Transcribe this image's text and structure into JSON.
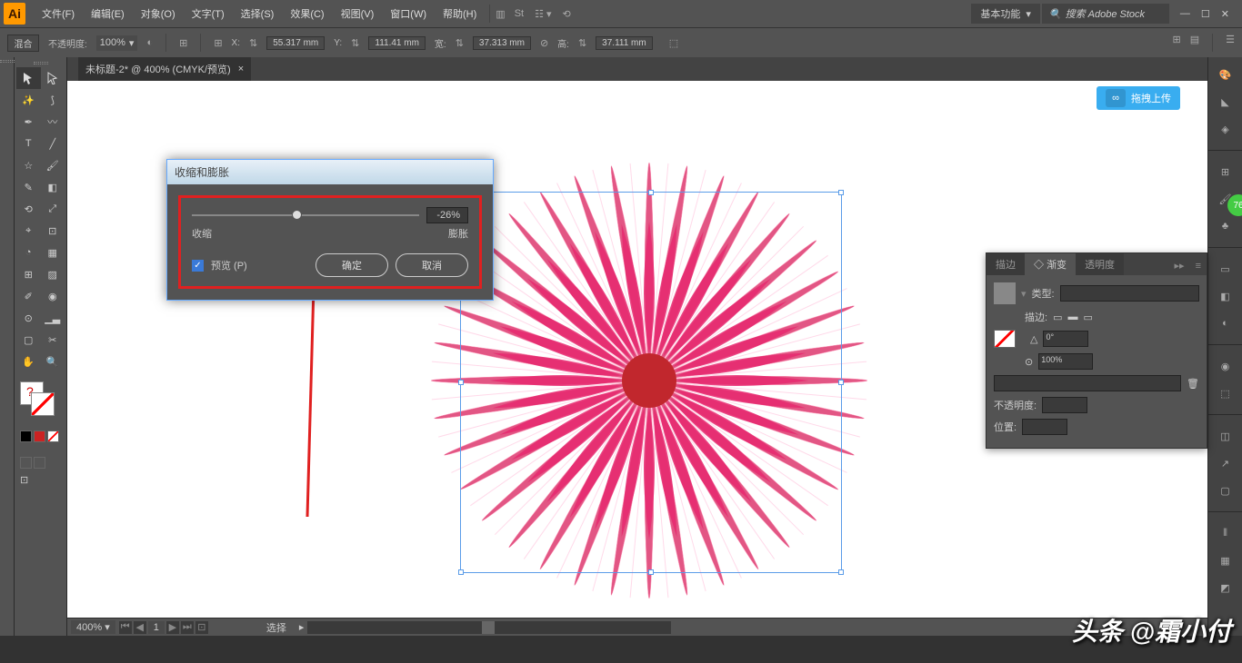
{
  "menu": {
    "file": "文件(F)",
    "edit": "编辑(E)",
    "object": "对象(O)",
    "type": "文字(T)",
    "select": "选择(S)",
    "effect": "效果(C)",
    "view": "视图(V)",
    "window": "窗口(W)",
    "help": "帮助(H)"
  },
  "workspace": "基本功能",
  "search_placeholder": "搜索 Adobe Stock",
  "options": {
    "blend": "混合",
    "opacity_label": "不透明度:",
    "opacity": "100%",
    "x_label": "X:",
    "x": "55.317 mm",
    "y_label": "Y:",
    "y": "111.41 mm",
    "w_label": "宽:",
    "w": "37.313 mm",
    "h_label": "高:",
    "h": "37.111 mm"
  },
  "doc_tab": "未标题-2* @ 400% (CMYK/预览)",
  "upload": "拖拽上传",
  "dialog": {
    "title": "收缩和膨胀",
    "value": "-26%",
    "shrink": "收缩",
    "expand": "膨胀",
    "preview": "预览 (P)",
    "ok": "确定",
    "cancel": "取消"
  },
  "panel": {
    "tab_stroke": "描边",
    "tab_gradient": "渐变",
    "tab_transparency": "透明度",
    "type_label": "类型:",
    "stroke_label": "描边:",
    "angle": "0°",
    "ratio": "100%",
    "opacity_label": "不透明度:",
    "location_label": "位置:"
  },
  "status": {
    "zoom": "400%",
    "page": "1",
    "mode": "选择"
  },
  "watermark": "头条 @霜小付",
  "badge": "76"
}
